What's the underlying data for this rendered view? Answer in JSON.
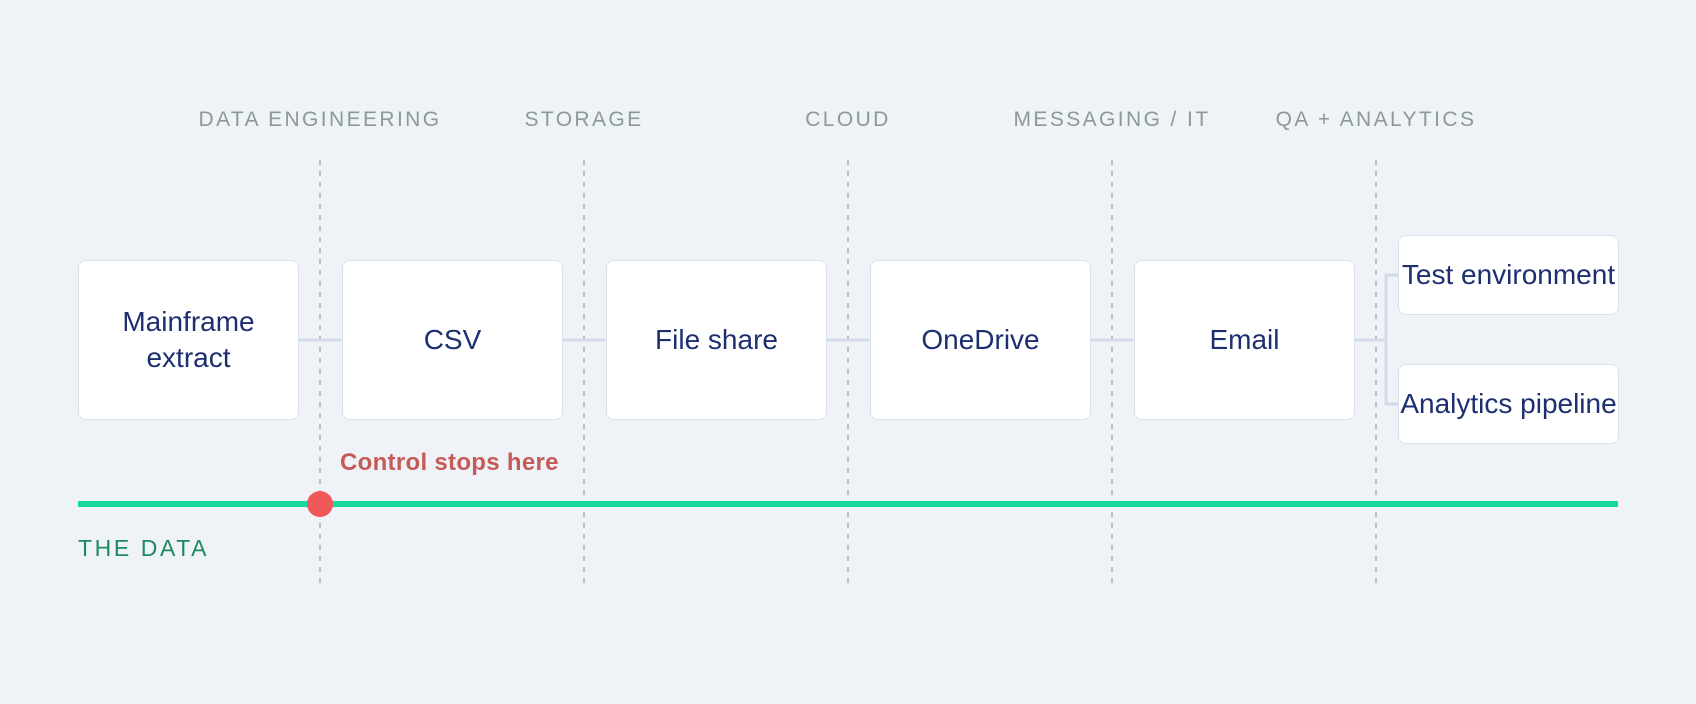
{
  "headers": [
    {
      "label": "DATA ENGINEERING"
    },
    {
      "label": "STORAGE"
    },
    {
      "label": "CLOUD"
    },
    {
      "label": "MESSAGING / IT"
    },
    {
      "label": "QA + ANALYTICS"
    }
  ],
  "nodes": [
    {
      "label": "Mainframe\nextract"
    },
    {
      "label": "CSV"
    },
    {
      "label": "File share"
    },
    {
      "label": "OneDrive"
    },
    {
      "label": "Email"
    }
  ],
  "branches": [
    {
      "label": "Test environment"
    },
    {
      "label": "Analytics pipeline"
    }
  ],
  "control_label": "Control stops here",
  "data_line_label": "THE DATA",
  "colors": {
    "background": "#eff3f8",
    "header_text": "#8a9a94",
    "node_text": "#1d2f6f",
    "node_border": "#d9e1ec",
    "connector": "#d3dbe8",
    "divider": "#a9b1b8",
    "data_line": "#17d99b",
    "data_label": "#1c8a5f",
    "control_dot": "#f0575a",
    "control_text": "#c65a57"
  }
}
